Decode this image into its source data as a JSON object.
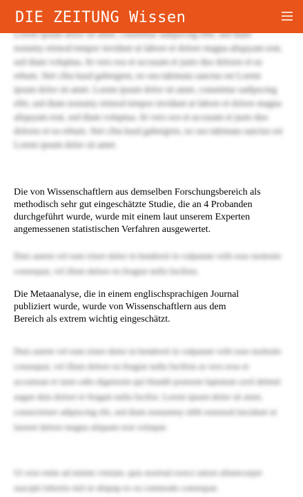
{
  "header": {
    "title": "DIE ZEITUNG Wissen",
    "menu_icon": "hamburger-menu-icon",
    "background_color": "#e8541a",
    "text_color": "#ffffff"
  },
  "article": {
    "blurred_1": "Lorem ipsum dolor sit amet, consetetur sadipscing elitr, sed diam nonumy eirmod tempor invidunt ut labore et dolore magna aliquyam erat, sed diam voluptua. At vero eos et accusam et justo duo dolores et ea rebum. Stet clita kasd gubergren, no sea takimata sanctus est Lorem ipsum dolor sit amet. Lorem ipsum dolor sit amet, consetetur sadipscing elitr, sed diam nonumy eirmod tempor invidunt ut labore et dolore magna aliquyam erat, sed diam voluptua. At vero eos et accusam et justo duo dolores et ea rebum. Stet clita kasd gubergren, no sea takimata sanctus est Lorem ipsum dolor sit amet.",
    "paragraph_1": "Die von Wissenschaftlern aus demselben Forschungsbereich als methodisch sehr gut eingeschätzte Studie, die an 4 Probanden durchgeführt wurde, wurde mit einem laut unserem Experten angemessenen statistischen Verfahren ausgewertet.",
    "blurred_2": "Duis autem vel eum iriure dolor in hendrerit in vulputate velit esse molestie consequat, vel illum dolore eu feugiat nulla facilisis.",
    "paragraph_2": "Die Metaanalyse, die in einem englischsprachigen Journal publiziert wurde, wurde von Wissenschaftlern aus dem Bereich als extrem wichtig eingeschätzt.",
    "blurred_3": "Duis autem vel eum iriure dolor in hendrerit in vulputate velit esse molestie consequat, vel illum dolore eu feugiat nulla facilisis at vero eros et accumsan et iusto odio dignissim qui blandit praesent luptatum zzril delenit augue duis dolore te feugait nulla facilisi. Lorem ipsum dolor sit amet, consectetuer adipiscing elit, sed diam nonummy nibh euismod tincidunt ut laoreet dolore magna aliquam erat volutpat.",
    "blurred_4": "Ut wisi enim ad minim veniam, quis nostrud exerci tation ullamcorper suscipit lobortis nisl ut aliquip ex ea commodo consequat."
  }
}
